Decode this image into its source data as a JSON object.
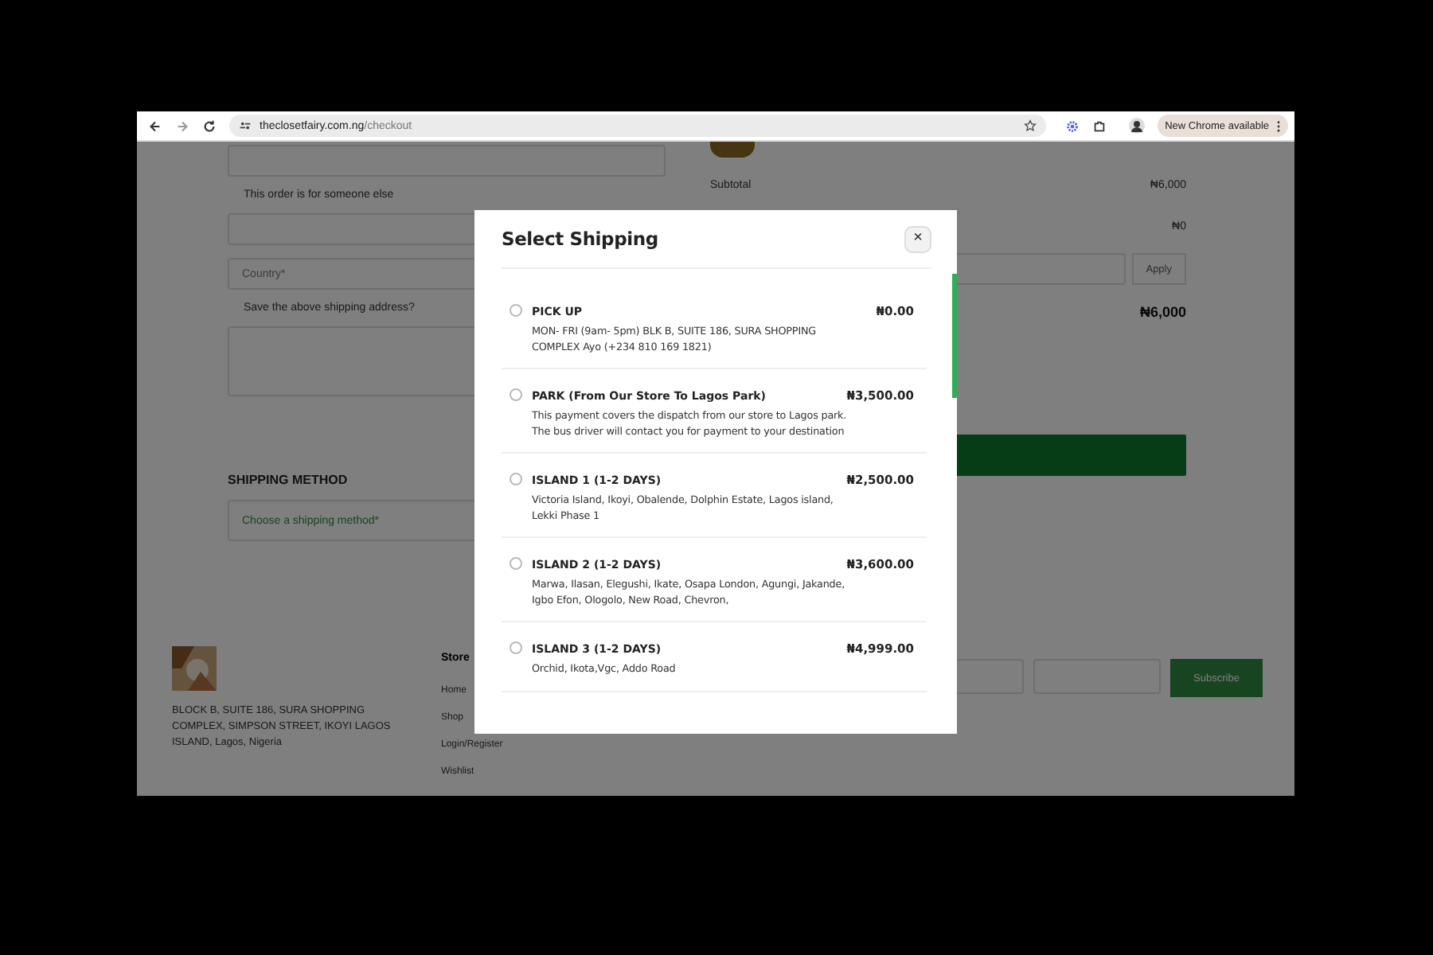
{
  "browser": {
    "url_host": "theclosetfairy.com.ng",
    "url_path": "/checkout",
    "update_badge": "New Chrome available"
  },
  "checkout": {
    "fields": [
      {
        "kind": "input"
      },
      {
        "kind": "checkbox",
        "label": "This order is for someone else"
      },
      {
        "kind": "input"
      },
      {
        "kind": "select",
        "placeholder": "Country*"
      },
      {
        "kind": "checkbox",
        "label": "Save the above shipping address?"
      },
      {
        "kind": "textarea"
      }
    ],
    "shipping_heading": "SHIPPING METHOD",
    "shipping_placeholder": "Choose a shipping method*"
  },
  "summary": {
    "rows": [
      {
        "label": "Subtotal",
        "value": "₦6,000"
      },
      {
        "value": "₦0"
      }
    ],
    "coupon_button": "Apply",
    "total": "₦6,000"
  },
  "footer": {
    "address": "BLOCK B, SUITE 186, SURA SHOPPING COMPLEX, SIMPSON STREET, IKOYI LAGOS ISLAND, Lagos, Nigeria",
    "store_heading": "Store",
    "links": [
      "Home",
      "Shop",
      "Login/Register",
      "Wishlist"
    ],
    "subscribe_button": "Subscribe"
  },
  "modal": {
    "title": "Select Shipping",
    "close": "×",
    "options": [
      {
        "name": "PICK UP",
        "price": "₦0.00",
        "description": "MON- FRI (9am- 5pm) BLK B, SUITE 186, SURA SHOPPING COMPLEX Ayo (+234 810 169 1821)",
        "selected": false
      },
      {
        "name": "PARK (From Our Store To Lagos Park)",
        "price": "₦3,500.00",
        "description": "This payment covers the dispatch from our store to Lagos park. The bus driver will contact you for payment to your destination",
        "selected": false
      },
      {
        "name": "ISLAND 1 (1-2 DAYS)",
        "price": "₦2,500.00",
        "description": "Victoria Island, Ikoyi, Obalende, Dolphin Estate, Lagos island, Lekki Phase 1",
        "selected": false
      },
      {
        "name": "ISLAND 2 (1-2 DAYS)",
        "price": "₦3,600.00",
        "description": "Marwa, Ilasan, Elegushi, Ikate, Osapa London, Agungi, Jakande, Igbo Efon, Ologolo, New Road, Chevron,",
        "selected": false
      },
      {
        "name": "ISLAND 3 (1-2 DAYS)",
        "price": "₦4,999.00",
        "description": "Orchid, Ikota,Vgc, Addo Road",
        "selected": false
      }
    ]
  }
}
